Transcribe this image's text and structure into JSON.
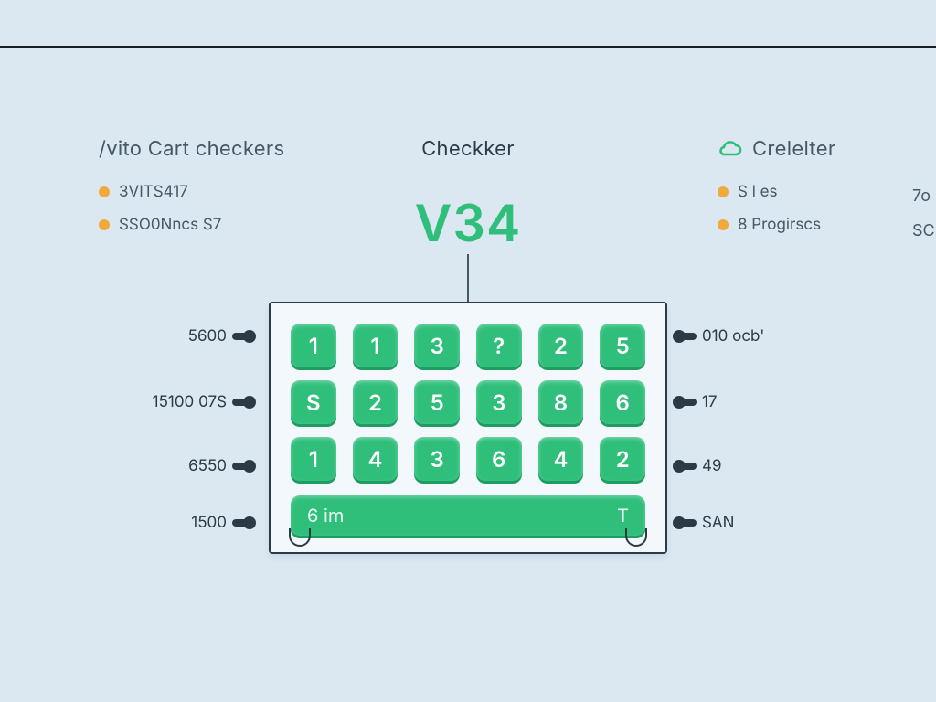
{
  "top_divider": true,
  "columns": {
    "left": {
      "title": "/vito Cart checkers",
      "bullets": [
        "3VITS417",
        "SSO0Nncs S7"
      ]
    },
    "center": {
      "title": "Checkker"
    },
    "right": {
      "title": "Crelelter",
      "bullets": [
        "S l es",
        "8 Progirscs"
      ],
      "edge": [
        "7o",
        "SC"
      ]
    }
  },
  "version": "V34",
  "panel": {
    "grid": [
      [
        "1",
        "1",
        "3",
        "?",
        "2",
        "5"
      ],
      [
        "S",
        "2",
        "5",
        "3",
        "8",
        "6"
      ],
      [
        "1",
        "4",
        "3",
        "6",
        "4",
        "2"
      ]
    ],
    "bottom_bar": {
      "left": "6 im",
      "right": "T"
    }
  },
  "axis": {
    "left": [
      "5600",
      "15100 07S",
      "6550",
      "1500"
    ],
    "right": [
      "010 ocb'",
      "17",
      "49",
      "SAN"
    ]
  }
}
